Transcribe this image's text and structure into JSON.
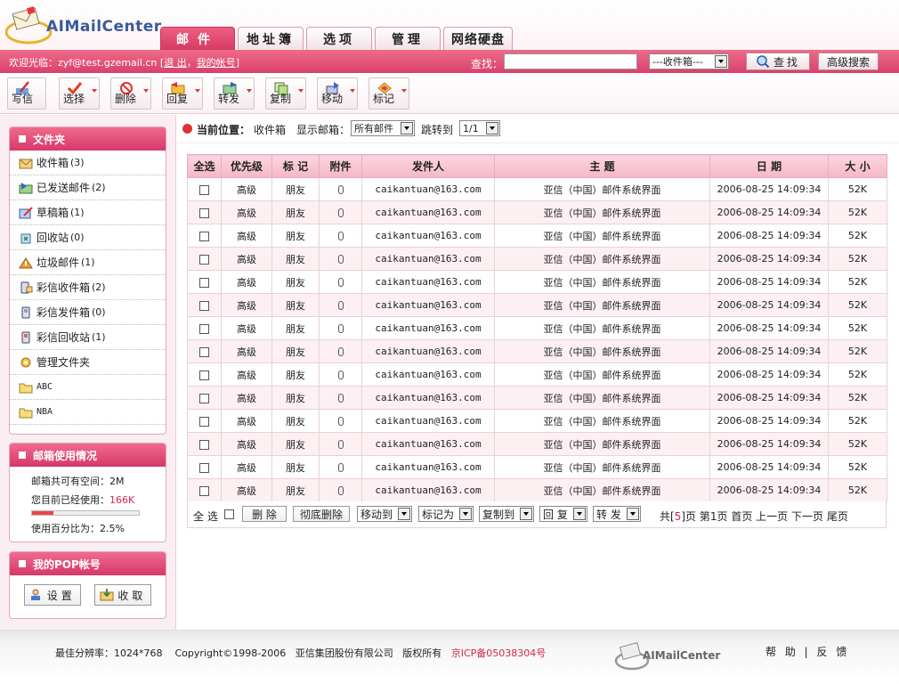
{
  "brand": {
    "name": "AIMailCenter"
  },
  "tabs": [
    {
      "label": "邮件",
      "active": true
    },
    {
      "label": "地址簿"
    },
    {
      "label": "选项"
    },
    {
      "label": "管理"
    },
    {
      "label": "网络硬盘"
    }
  ],
  "topbar": {
    "welcome": "欢迎光临：zyf@test.gzemail.cn",
    "bracket_open": "[",
    "logout": "退 出",
    "separator": "，",
    "my_account": "我的帐号",
    "bracket_close": "]",
    "search_label": "查找：",
    "search_value": "",
    "folder_select": "---收件箱---",
    "find_button": "查找",
    "advanced_button": "高级搜索"
  },
  "toolbar": [
    {
      "label": "写信",
      "icon": "compose-icon",
      "dropdown": false
    },
    {
      "label": "选择",
      "icon": "check-icon",
      "dropdown": true
    },
    {
      "label": "删除",
      "icon": "delete-icon",
      "dropdown": true
    },
    {
      "label": "回复",
      "icon": "reply-icon",
      "dropdown": true
    },
    {
      "label": "转发",
      "icon": "forward-icon",
      "dropdown": true
    },
    {
      "label": "复制",
      "icon": "copy-icon",
      "dropdown": true
    },
    {
      "label": "移动",
      "icon": "move-icon",
      "dropdown": true
    },
    {
      "label": "标记",
      "icon": "flag-icon",
      "dropdown": true
    }
  ],
  "sidebar": {
    "folders_title": "文件夹",
    "folders": [
      {
        "name": "收件箱",
        "count": "(3)",
        "icon": "inbox-icon"
      },
      {
        "name": "已发送邮件",
        "count": "(2)",
        "icon": "sent-icon"
      },
      {
        "name": "草稿箱",
        "count": "(1)",
        "icon": "drafts-icon"
      },
      {
        "name": "回收站",
        "count": "(0)",
        "icon": "trash-icon"
      },
      {
        "name": "垃圾邮件",
        "count": "(1)",
        "icon": "spam-icon"
      },
      {
        "name": "彩信收件箱",
        "count": "(2)",
        "icon": "mms-inbox-icon"
      },
      {
        "name": "彩信发件箱",
        "count": "(0)",
        "icon": "mms-outbox-icon"
      },
      {
        "name": "彩信回收站",
        "count": "(1)",
        "icon": "mms-trash-icon"
      },
      {
        "name": "管理文件夹",
        "count": "",
        "icon": "manage-folder-icon"
      },
      {
        "name": "ABC",
        "count": "",
        "icon": "folder-icon"
      },
      {
        "name": "NBA",
        "count": "",
        "icon": "folder-icon"
      }
    ],
    "usage_title": "邮箱使用情况",
    "usage_total_label": "邮箱共可有空间：",
    "usage_total": "2M",
    "usage_used_label": "您目前已经使用：",
    "usage_used": "166K",
    "usage_percent_label": "使用百分比为：",
    "usage_percent": "2.5%",
    "usage_fraction": 0.025,
    "pop_title": "我的POP帐号",
    "pop_settings": "设置",
    "pop_receive": "收取"
  },
  "location": {
    "label": "当前位置：",
    "value": "收件箱",
    "show_label": "显示邮箱：",
    "show_value": "所有邮件",
    "jump_label": "跳转到",
    "jump_value": "1/1"
  },
  "table": {
    "headers": [
      "全选",
      "优先级",
      "标 记",
      "附件",
      "发件人",
      "主 题",
      "日 期",
      "大 小"
    ],
    "rows": [
      {
        "priority": "高级",
        "tag": "朋友",
        "sender": "caikantuan@163.com",
        "subject": "亚信（中国）邮件系统界面",
        "date": "2006-08-25 14:09:34",
        "size": "52K"
      },
      {
        "priority": "高级",
        "tag": "朋友",
        "sender": "caikantuan@163.com",
        "subject": "亚信（中国）邮件系统界面",
        "date": "2006-08-25 14:09:34",
        "size": "52K"
      },
      {
        "priority": "高级",
        "tag": "朋友",
        "sender": "caikantuan@163.com",
        "subject": "亚信（中国）邮件系统界面",
        "date": "2006-08-25 14:09:34",
        "size": "52K"
      },
      {
        "priority": "高级",
        "tag": "朋友",
        "sender": "caikantuan@163.com",
        "subject": "亚信（中国）邮件系统界面",
        "date": "2006-08-25 14:09:34",
        "size": "52K"
      },
      {
        "priority": "高级",
        "tag": "朋友",
        "sender": "caikantuan@163.com",
        "subject": "亚信（中国）邮件系统界面",
        "date": "2006-08-25 14:09:34",
        "size": "52K"
      },
      {
        "priority": "高级",
        "tag": "朋友",
        "sender": "caikantuan@163.com",
        "subject": "亚信（中国）邮件系统界面",
        "date": "2006-08-25 14:09:34",
        "size": "52K"
      },
      {
        "priority": "高级",
        "tag": "朋友",
        "sender": "caikantuan@163.com",
        "subject": "亚信（中国）邮件系统界面",
        "date": "2006-08-25 14:09:34",
        "size": "52K"
      },
      {
        "priority": "高级",
        "tag": "朋友",
        "sender": "caikantuan@163.com",
        "subject": "亚信（中国）邮件系统界面",
        "date": "2006-08-25 14:09:34",
        "size": "52K"
      },
      {
        "priority": "高级",
        "tag": "朋友",
        "sender": "caikantuan@163.com",
        "subject": "亚信（中国）邮件系统界面",
        "date": "2006-08-25 14:09:34",
        "size": "52K"
      },
      {
        "priority": "高级",
        "tag": "朋友",
        "sender": "caikantuan@163.com",
        "subject": "亚信（中国）邮件系统界面",
        "date": "2006-08-25 14:09:34",
        "size": "52K"
      },
      {
        "priority": "高级",
        "tag": "朋友",
        "sender": "caikantuan@163.com",
        "subject": "亚信（中国）邮件系统界面",
        "date": "2006-08-25 14:09:34",
        "size": "52K"
      },
      {
        "priority": "高级",
        "tag": "朋友",
        "sender": "caikantuan@163.com",
        "subject": "亚信（中国）邮件系统界面",
        "date": "2006-08-25 14:09:34",
        "size": "52K"
      },
      {
        "priority": "高级",
        "tag": "朋友",
        "sender": "caikantuan@163.com",
        "subject": "亚信（中国）邮件系统界面",
        "date": "2006-08-25 14:09:34",
        "size": "52K"
      },
      {
        "priority": "高级",
        "tag": "朋友",
        "sender": "caikantuan@163.com",
        "subject": "亚信（中国）邮件系统界面",
        "date": "2006-08-25 14:09:34",
        "size": "52K"
      }
    ]
  },
  "table_footer": {
    "select_all": "全 选",
    "delete": "删 除",
    "perm_delete": "彻底删除",
    "move_to": "移动到",
    "mark_as": "标记为",
    "copy_to": "复制到",
    "reply": "回 复",
    "forward": "转 发",
    "pager_prefix": "共[",
    "pager_pages": "5",
    "pager_suffix": "]页",
    "current_page": "第1页",
    "first": "首页",
    "prev": "上一页",
    "next": "下一页",
    "last": "尾页"
  },
  "footer": {
    "resolution": "最佳分辨率：1024*768",
    "copyright": "Copyright©1998-2006",
    "company": "亚信集团股份有限公司",
    "rights": "版权所有",
    "icp": "京ICP备05038304号",
    "help": "帮 助",
    "link_sep": "|",
    "feedback": "反 馈"
  },
  "colors": {
    "accent": "#d9416a",
    "link_red": "#d1284a"
  }
}
